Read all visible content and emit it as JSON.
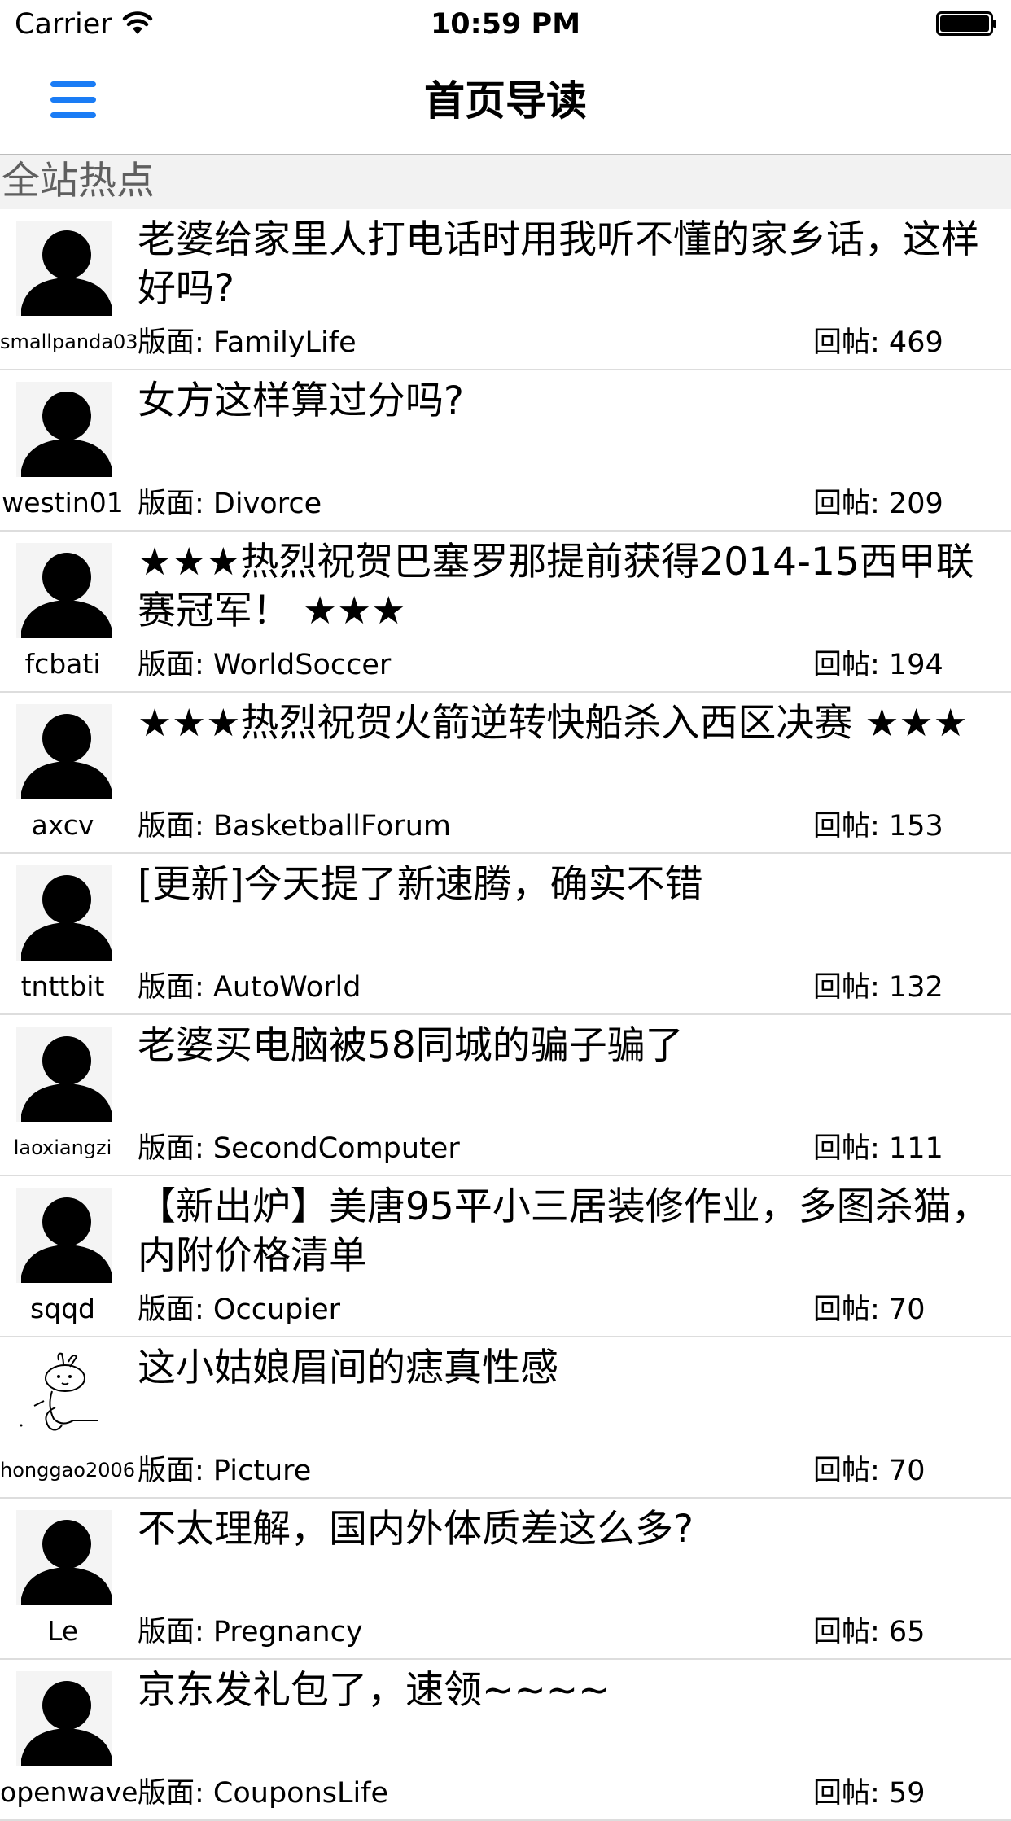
{
  "status_bar": {
    "carrier": "Carrier",
    "time": "10:59 PM"
  },
  "nav": {
    "title": "首页导读",
    "menu_icon": "hamburger-menu-icon",
    "accent_color": "#1a7cf5"
  },
  "section": {
    "title": "全站热点"
  },
  "labels": {
    "board_prefix": "版面: ",
    "reply_prefix": "回帖: "
  },
  "posts": [
    {
      "author": "smallpanda03",
      "title": "老婆给家里人打电话时用我听不懂的家乡话，这样好吗?",
      "board": "FamilyLife",
      "replies": "469",
      "avatar": "default-person-icon"
    },
    {
      "author": "westin01",
      "title": "女方这样算过分吗?",
      "board": "Divorce",
      "replies": "209",
      "avatar": "default-person-icon"
    },
    {
      "author": "fcbati",
      "title": "★★★热烈祝贺巴塞罗那提前获得2014-15西甲联赛冠军！ ★★★",
      "board": "WorldSoccer",
      "replies": "194",
      "avatar": "default-person-icon"
    },
    {
      "author": "axcv",
      "title": "★★★热烈祝贺火箭逆转快船杀入西区决赛 ★★★",
      "board": "BasketballForum",
      "replies": "153",
      "avatar": "default-person-icon"
    },
    {
      "author": "tnttbit",
      "title": "[更新]今天提了新速腾，确实不错",
      "board": "AutoWorld",
      "replies": "132",
      "avatar": "default-person-icon"
    },
    {
      "author": "laoxiangzi",
      "title": "老婆买电脑被58同城的骗子骗了",
      "board": "SecondComputer",
      "replies": "111",
      "avatar": "default-person-icon"
    },
    {
      "author": "sqqd",
      "title": "【新出炉】美唐95平小三居装修作业，多图杀猫，内附价格清单",
      "board": "Occupier",
      "replies": "70",
      "avatar": "default-person-icon"
    },
    {
      "author": "honggao2006",
      "title": "这小姑娘眉间的痣真性感",
      "board": "Picture",
      "replies": "70",
      "avatar": "rabbit-sketch-icon"
    },
    {
      "author": "Le",
      "title": "不太理解，国内外体质差这么多?",
      "board": "Pregnancy",
      "replies": "65",
      "avatar": "default-person-icon"
    },
    {
      "author": "openwave",
      "title": "京东发礼包了，速领~~~~",
      "board": "CouponsLife",
      "replies": "59",
      "avatar": "default-person-icon"
    }
  ]
}
